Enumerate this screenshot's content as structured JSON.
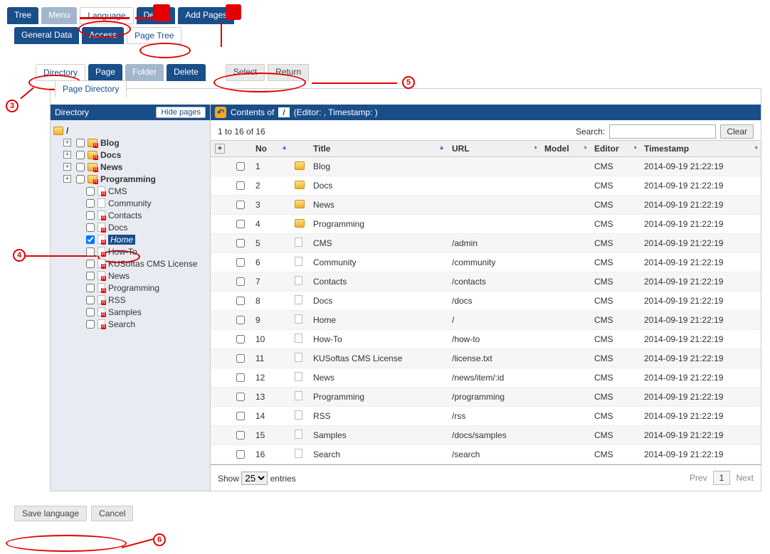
{
  "topTabs": {
    "tree": "Tree",
    "menu": "Menu",
    "language": "Language",
    "delete": "Delete",
    "addPages": "Add Pages"
  },
  "subTabs": {
    "generalData": "General Data",
    "access": "Access",
    "pageTree": "Page Tree"
  },
  "toolTabs": {
    "directory": "Directory",
    "page": "Page",
    "folder": "Folder",
    "delete": "Delete",
    "select": "Select",
    "return": "Return"
  },
  "panelTab": "Page Directory",
  "leftHeader": "Directory",
  "hidePages": "Hide pages",
  "treeRoot": "/",
  "treeFolders": [
    "Blog",
    "Docs",
    "News",
    "Programming"
  ],
  "treePages": [
    "CMS",
    "Community",
    "Contacts",
    "Docs",
    "Home",
    "How-To",
    "KUSoftas CMS License",
    "News",
    "Programming",
    "RSS",
    "Samples",
    "Search"
  ],
  "treeSelected": "Home",
  "contentsLabel": "Contents of",
  "contentsPath": "/",
  "editorLine": "(Editor: , Timestamp: )",
  "rangeText": "1 to 16 of 16",
  "searchLabel": "Search:",
  "clearLabel": "Clear",
  "columns": {
    "no": "No",
    "title": "Title",
    "url": "URL",
    "model": "Model",
    "editor": "Editor",
    "timestamp": "Timestamp"
  },
  "rows": [
    {
      "no": 1,
      "type": "folder",
      "title": "Blog",
      "url": "",
      "model": "",
      "editor": "CMS",
      "ts": "2014-09-19 21:22:19"
    },
    {
      "no": 2,
      "type": "folder",
      "title": "Docs",
      "url": "",
      "model": "",
      "editor": "CMS",
      "ts": "2014-09-19 21:22:19"
    },
    {
      "no": 3,
      "type": "folder",
      "title": "News",
      "url": "",
      "model": "",
      "editor": "CMS",
      "ts": "2014-09-19 21:22:19"
    },
    {
      "no": 4,
      "type": "folder",
      "title": "Programming",
      "url": "",
      "model": "",
      "editor": "CMS",
      "ts": "2014-09-19 21:22:19"
    },
    {
      "no": 5,
      "type": "page",
      "title": "CMS",
      "url": "/admin",
      "model": "",
      "editor": "CMS",
      "ts": "2014-09-19 21:22:19"
    },
    {
      "no": 6,
      "type": "page",
      "title": "Community",
      "url": "/community",
      "model": "",
      "editor": "CMS",
      "ts": "2014-09-19 21:22:19"
    },
    {
      "no": 7,
      "type": "page",
      "title": "Contacts",
      "url": "/contacts",
      "model": "",
      "editor": "CMS",
      "ts": "2014-09-19 21:22:19"
    },
    {
      "no": 8,
      "type": "page",
      "title": "Docs",
      "url": "/docs",
      "model": "",
      "editor": "CMS",
      "ts": "2014-09-19 21:22:19"
    },
    {
      "no": 9,
      "type": "page",
      "title": "Home",
      "url": "/",
      "model": "",
      "editor": "CMS",
      "ts": "2014-09-19 21:22:19"
    },
    {
      "no": 10,
      "type": "page",
      "title": "How-To",
      "url": "/how-to",
      "model": "",
      "editor": "CMS",
      "ts": "2014-09-19 21:22:19"
    },
    {
      "no": 11,
      "type": "page",
      "title": "KUSoftas CMS License",
      "url": "/license.txt",
      "model": "",
      "editor": "CMS",
      "ts": "2014-09-19 21:22:19"
    },
    {
      "no": 12,
      "type": "page",
      "title": "News",
      "url": "/news/item/:id",
      "model": "",
      "editor": "CMS",
      "ts": "2014-09-19 21:22:19"
    },
    {
      "no": 13,
      "type": "page",
      "title": "Programming",
      "url": "/programming",
      "model": "",
      "editor": "CMS",
      "ts": "2014-09-19 21:22:19"
    },
    {
      "no": 14,
      "type": "page",
      "title": "RSS",
      "url": "/rss",
      "model": "",
      "editor": "CMS",
      "ts": "2014-09-19 21:22:19"
    },
    {
      "no": 15,
      "type": "page",
      "title": "Samples",
      "url": "/docs/samples",
      "model": "",
      "editor": "CMS",
      "ts": "2014-09-19 21:22:19"
    },
    {
      "no": 16,
      "type": "page",
      "title": "Search",
      "url": "/search",
      "model": "",
      "editor": "CMS",
      "ts": "2014-09-19 21:22:19"
    }
  ],
  "showLabel": "Show",
  "entriesLabel": "entries",
  "pageSize": "25",
  "prev": "Prev",
  "next": "Next",
  "pageNum": "1",
  "save": "Save language",
  "cancel": "Cancel",
  "callouts": {
    "3": "3",
    "4": "4",
    "5": "5",
    "6": "6"
  }
}
